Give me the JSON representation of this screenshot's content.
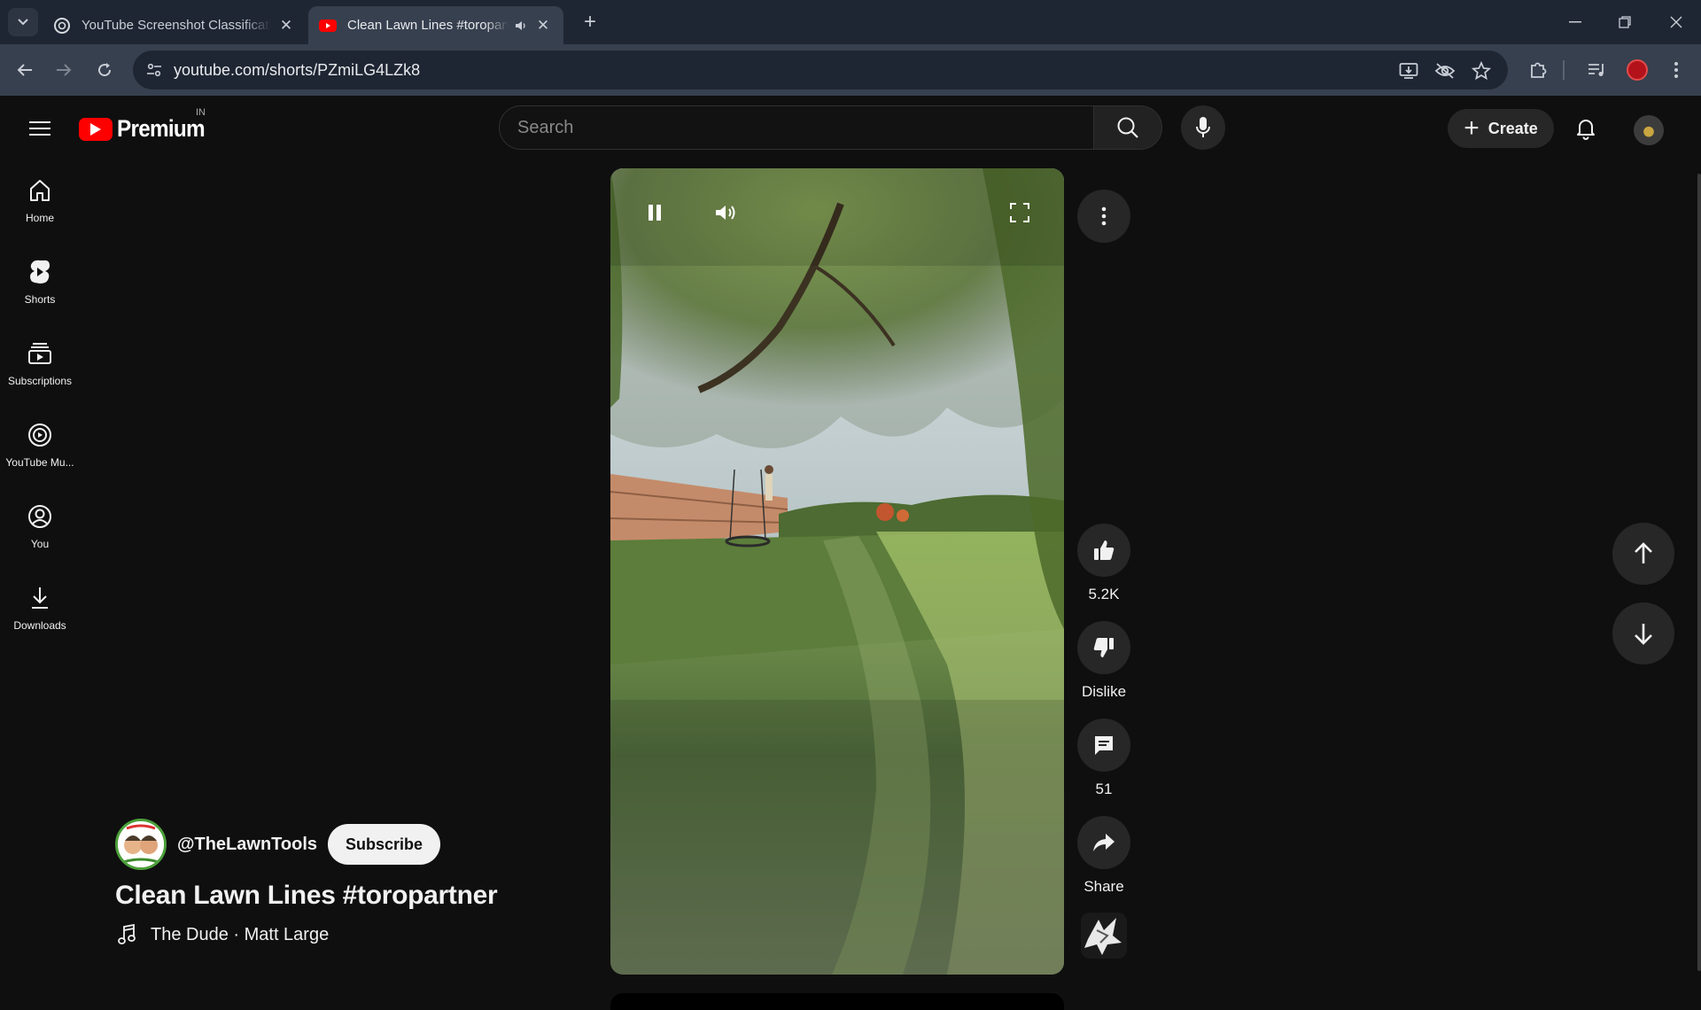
{
  "browser": {
    "tabs": [
      {
        "title": "YouTube Screenshot Classificati",
        "active": false,
        "icon": "openai-icon"
      },
      {
        "title": "Clean Lawn Lines #toropartner",
        "active": true,
        "icon": "youtube-icon",
        "audio": true
      }
    ],
    "url": "youtube.com/shorts/PZmiLG4LZk8"
  },
  "masthead": {
    "logo_text": "Premium",
    "country_code": "IN",
    "search_placeholder": "Search",
    "create_label": "Create"
  },
  "guide": {
    "items": [
      {
        "label": "Home",
        "icon": "home-icon"
      },
      {
        "label": "Shorts",
        "icon": "shorts-icon"
      },
      {
        "label": "Subscriptions",
        "icon": "subscriptions-icon"
      },
      {
        "label": "YouTube Mu...",
        "icon": "youtube-music-icon"
      },
      {
        "label": "You",
        "icon": "account-icon"
      },
      {
        "label": "Downloads",
        "icon": "download-icon"
      }
    ]
  },
  "short": {
    "channel_handle": "@TheLawnTools",
    "subscribe_label": "Subscribe",
    "title": "Clean Lawn Lines #toropartner",
    "music": "The Dude · Matt Large",
    "actions": {
      "likes": "5.2K",
      "dislike_label": "Dislike",
      "comments": "51",
      "share_label": "Share"
    }
  },
  "colors": {
    "background": "#0f0f0f",
    "chip": "#272727",
    "brand_red": "#ff0000",
    "browser_frame": "#1f2633",
    "browser_toolbar": "#37404f"
  }
}
